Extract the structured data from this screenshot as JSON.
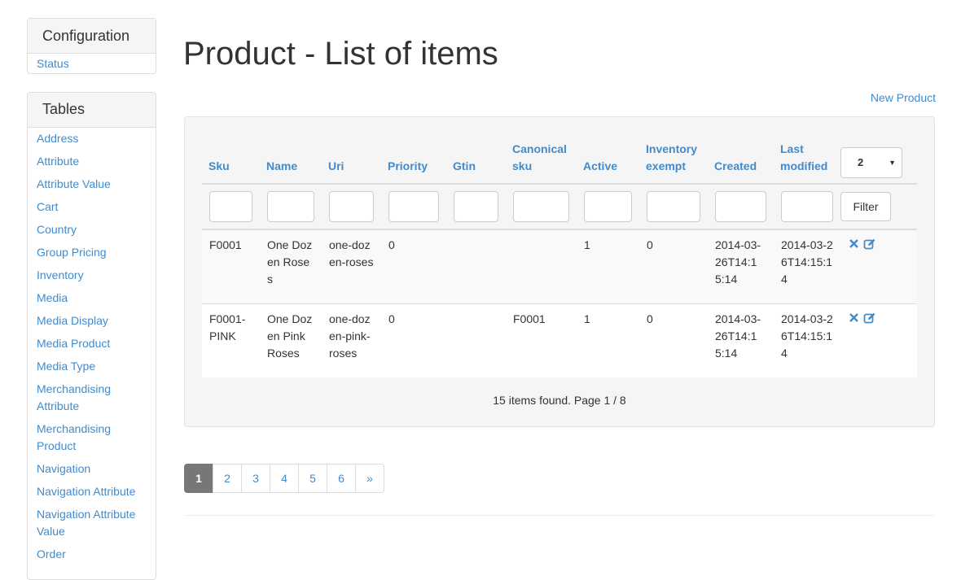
{
  "sidebar": {
    "config_title": "Configuration",
    "config_items": [
      "Status"
    ],
    "tables_title": "Tables",
    "tables_items": [
      "Address",
      "Attribute",
      "Attribute Value",
      "Cart",
      "Country",
      "Group Pricing",
      "Inventory",
      "Media",
      "Media Display",
      "Media Product",
      "Media Type",
      "Merchandising Attribute",
      "Merchandising Product",
      "Navigation",
      "Navigation Attribute",
      "Navigation Attribute Value",
      "Order"
    ]
  },
  "main": {
    "title": "Product - List of items",
    "new_link": "New Product",
    "columns": [
      "Sku",
      "Name",
      "Uri",
      "Priority",
      "Gtin",
      "Canonical sku",
      "Active",
      "Inventory exempt",
      "Created",
      "Last modified"
    ],
    "page_size_selected": "2",
    "filter_button": "Filter",
    "rows": [
      {
        "sku": "F0001",
        "name": "One Dozen Roses",
        "uri": "one-dozen-roses",
        "priority": "0",
        "gtin": "",
        "canonical_sku": "",
        "active": "1",
        "inventory_exempt": "0",
        "created": "2014-03-26T14:15:14",
        "last_modified": "2014-03-26T14:15:14"
      },
      {
        "sku": "F0001-PINK",
        "name": "One Dozen Pink Roses",
        "uri": "one-dozen-pink-roses",
        "priority": "0",
        "gtin": "",
        "canonical_sku": "F0001",
        "active": "1",
        "inventory_exempt": "0",
        "created": "2014-03-26T14:15:14",
        "last_modified": "2014-03-26T14:15:14"
      }
    ],
    "summary": "15 items found. Page 1 / 8",
    "pagination": [
      "1",
      "2",
      "3",
      "4",
      "5",
      "6",
      "»"
    ],
    "pagination_active": "1",
    "icons": {
      "delete": "remove-icon",
      "edit": "edit-icon"
    },
    "colors": {
      "link": "#428bca",
      "active_page": "#777777"
    }
  }
}
